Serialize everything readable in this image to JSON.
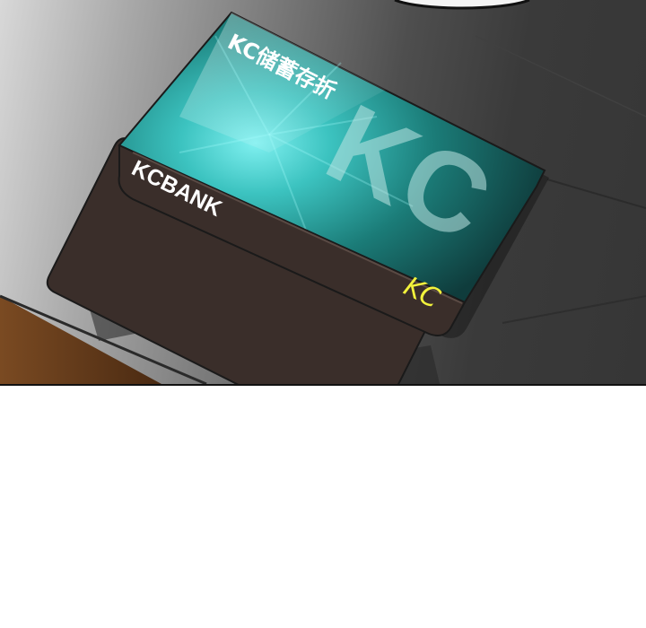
{
  "card": {
    "title": "KC储蓄存折",
    "bank_name": "KCBANK",
    "big_logo": "KC",
    "small_logo": "KC",
    "colors": {
      "card_top": "#1f8a84",
      "card_glow": "#5ce0e0",
      "card_bottom": "#3a2e2a",
      "small_logo": "#f2f23c"
    }
  }
}
